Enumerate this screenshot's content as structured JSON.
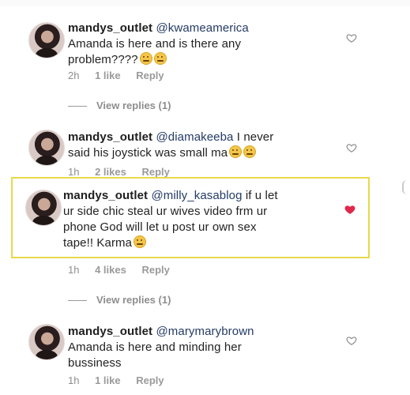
{
  "comments": [
    {
      "username": "mandys_outlet",
      "mention": "@kwameamerica",
      "text_line1": " ",
      "text_line2": "Amanda is here and is there any",
      "text_line3": "problem????",
      "emoji_count": 2,
      "time": "2h",
      "likes": "1 like",
      "reply": "Reply",
      "liked": false,
      "view_replies": "View replies (1)"
    },
    {
      "username": "mandys_outlet",
      "mention": "@diamakeeba",
      "text_line1": " I never",
      "text_line2": "said his joystick was small ma",
      "emoji_count": 2,
      "time": "1h",
      "likes": "2 likes",
      "reply": "Reply",
      "liked": false
    },
    {
      "username": "mandys_outlet",
      "mention": "@milly_kasablog",
      "text_line1": " if u let",
      "text_line2": "ur side chic steal ur wives video frm ur",
      "text_line3": "phone God will let u post ur own sex",
      "text_line4": "tape!! Karma",
      "emoji_count": 1,
      "time": "1h",
      "likes": "4 likes",
      "reply": "Reply",
      "liked": true,
      "view_replies": "View replies (1)"
    },
    {
      "username": "mandys_outlet",
      "mention": "@marymarybrown",
      "text_line2": "Amanda is here and minding her",
      "text_line3": "bussiness",
      "emoji_count": 0,
      "time": "1h",
      "likes": "1 like",
      "reply": "Reply",
      "liked": false
    }
  ],
  "colors": {
    "heart_liked": "#e0284b",
    "heart_outline": "#8a8a8a",
    "highlight_border": "#e8d94a"
  },
  "icons": {
    "heart": "heart-icon"
  }
}
